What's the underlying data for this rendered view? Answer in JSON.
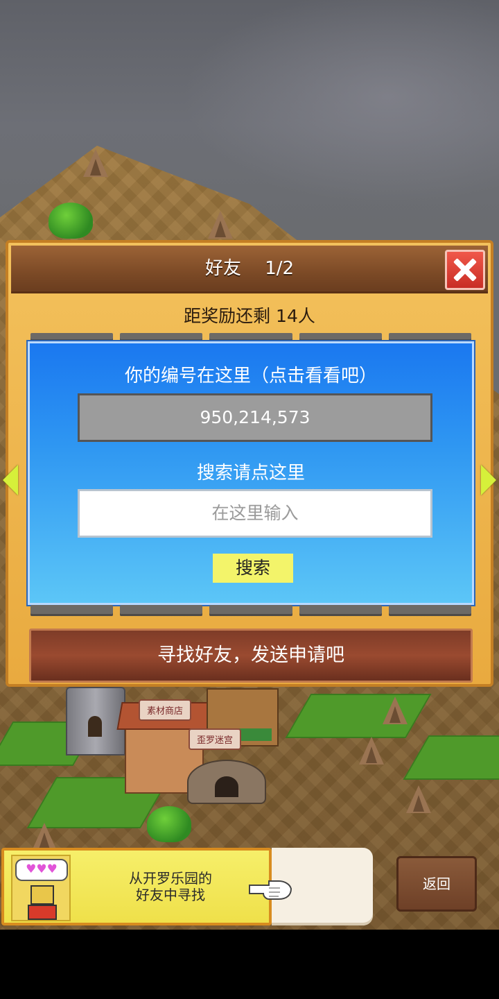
{
  "dialog": {
    "title": "好友　 1/2",
    "reward_text": "距奖励还剩 14人",
    "id_label": "你的编号在这里（点击看看吧）",
    "player_id": "950,214,573",
    "search_label": "搜索请点这里",
    "search_placeholder": "在这里输入",
    "search_button": "搜索",
    "find_friends_button": "寻找好友，发送申请吧"
  },
  "map_signs": {
    "material_shop": "素材商店",
    "maze": "歪罗迷宫"
  },
  "bottom": {
    "cairo_line1": "从开罗乐园的",
    "cairo_line2": "好友中寻找",
    "hearts": "♥♥♥",
    "back_button": "返回"
  },
  "icons": {
    "close": "close-icon",
    "prev_page": "arrow-left-icon",
    "next_page": "arrow-right-icon",
    "pointer": "pointing-hand-icon",
    "mascot": "kairobot-icon"
  }
}
